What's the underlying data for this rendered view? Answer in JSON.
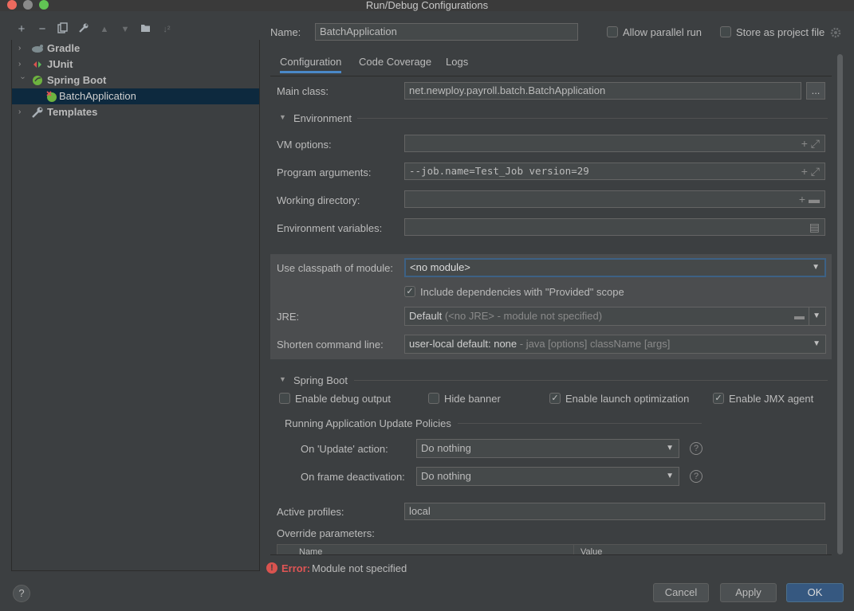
{
  "window": {
    "title": "Run/Debug Configurations"
  },
  "left_toolbar": {
    "icons": [
      "add-icon",
      "remove-icon",
      "copy-icon",
      "wrench-icon",
      "move-up-icon",
      "move-down-icon",
      "new-folder-icon",
      "sort-icon"
    ]
  },
  "tree": {
    "items": [
      {
        "label": "Gradle",
        "icon": "gradle-icon",
        "expanded": false
      },
      {
        "label": "JUnit",
        "icon": "junit-icon",
        "expanded": false
      },
      {
        "label": "Spring Boot",
        "icon": "spring-boot-icon",
        "expanded": true
      },
      {
        "label": "BatchApplication",
        "icon": "spring-boot-error-icon",
        "selected": true
      },
      {
        "label": "Templates",
        "icon": "wrench-icon",
        "expanded": false
      }
    ]
  },
  "header": {
    "name_label": "Name:",
    "name_value": "BatchApplication",
    "allow_parallel_label": "Allow parallel run",
    "store_project_label": "Store as project file"
  },
  "tabs": [
    {
      "label": "Configuration",
      "active": true
    },
    {
      "label": "Code Coverage"
    },
    {
      "label": "Logs"
    }
  ],
  "config": {
    "main_class_label": "Main class:",
    "main_class_value": "net.newploy.payroll.batch.BatchApplication",
    "browse_label": "...",
    "environment_title": "Environment",
    "vm_options_label": "VM options:",
    "vm_options_value": "",
    "program_args_label": "Program arguments:",
    "program_args_value": "--job.name=Test_Job version=29",
    "working_dir_label": "Working directory:",
    "working_dir_value": "",
    "env_vars_label": "Environment variables:",
    "env_vars_value": "",
    "classpath_label": "Use classpath of module:",
    "classpath_value": "<no module>",
    "include_deps_label": "Include dependencies with \"Provided\" scope",
    "jre_label": "JRE:",
    "jre_value": "Default",
    "jre_hint": "(<no JRE> - module not specified)",
    "shorten_label": "Shorten command line:",
    "shorten_value": "user-local default: none",
    "shorten_hint": "- java [options] className [args]"
  },
  "spring_boot": {
    "title": "Spring Boot",
    "debug_output_label": "Enable debug output",
    "hide_banner_label": "Hide banner",
    "launch_opt_label": "Enable launch optimization",
    "jmx_label": "Enable JMX agent",
    "policies_title": "Running Application Update Policies",
    "update_action_label": "On 'Update' action:",
    "update_action_value": "Do nothing",
    "frame_deactivation_label": "On frame deactivation:",
    "frame_deactivation_value": "Do nothing",
    "active_profiles_label": "Active profiles:",
    "active_profiles_value": "local",
    "override_params_label": "Override parameters:",
    "table_headers": [
      "Name",
      "Value"
    ]
  },
  "status": {
    "error_prefix": "Error:",
    "error_text": "Module not specified",
    "color": "#e05555"
  },
  "buttons": {
    "cancel": "Cancel",
    "apply": "Apply",
    "ok": "OK",
    "help": "?"
  },
  "colors": {
    "background": "#3c3f41",
    "selection": "#0d293e",
    "accent": "#4a88c7",
    "primary_button": "#365880"
  }
}
